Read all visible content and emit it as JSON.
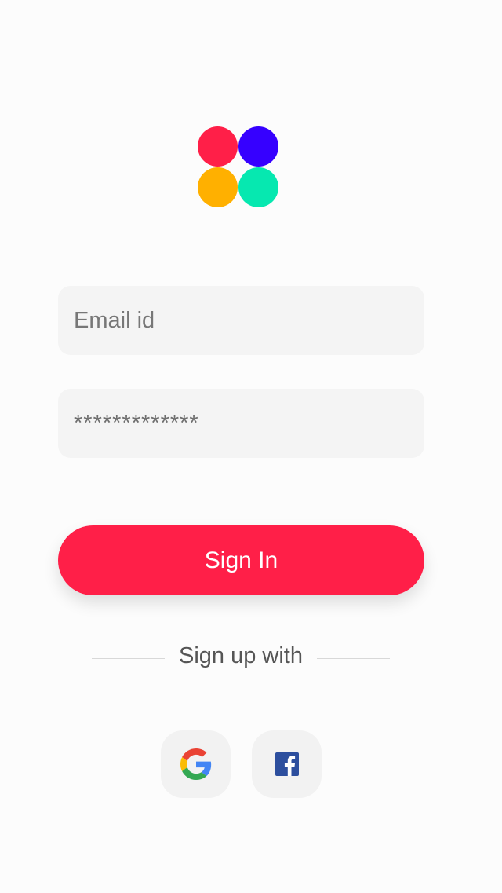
{
  "colors": {
    "logo_red": "#ff1f48",
    "logo_blue": "#3600ff",
    "logo_yellow": "#ffb000",
    "logo_teal": "#06e8b0",
    "accent": "#ff1f48",
    "field_background": "#f4f4f4",
    "facebook_blue": "#2d4f9e"
  },
  "form": {
    "email_placeholder": "Email id",
    "password_value": "*************"
  },
  "buttons": {
    "sign_in_label": "Sign In"
  },
  "divider": {
    "label": "Sign up with"
  },
  "social": [
    {
      "name": "Google",
      "icon": "google-icon"
    },
    {
      "name": "Facebook",
      "icon": "facebook-icon"
    }
  ]
}
